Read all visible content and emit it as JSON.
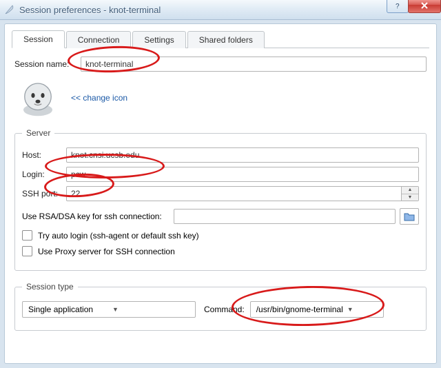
{
  "window": {
    "title": "Session preferences - knot-terminal"
  },
  "tabs": {
    "session": "Session",
    "connection": "Connection",
    "settings": "Settings",
    "shared": "Shared folders"
  },
  "session": {
    "name_label": "Session name:",
    "name_value": "knot-terminal",
    "change_icon": "<< change icon"
  },
  "server": {
    "legend": "Server",
    "host_label": "Host:",
    "host_value": "knot.cnsi.ucsb.edu",
    "login_label": "Login:",
    "login_value": "pcw",
    "sshport_label": "SSH port:",
    "sshport_value": "22",
    "rsakey_label": "Use RSA/DSA key for ssh connection:",
    "rsakey_value": "",
    "autologin_label": "Try auto login (ssh-agent or default ssh key)",
    "proxy_label": "Use Proxy server for SSH connection"
  },
  "session_type": {
    "legend": "Session type",
    "type_value": "Single application",
    "command_label": "Command:",
    "command_value": "/usr/bin/gnome-terminal"
  }
}
